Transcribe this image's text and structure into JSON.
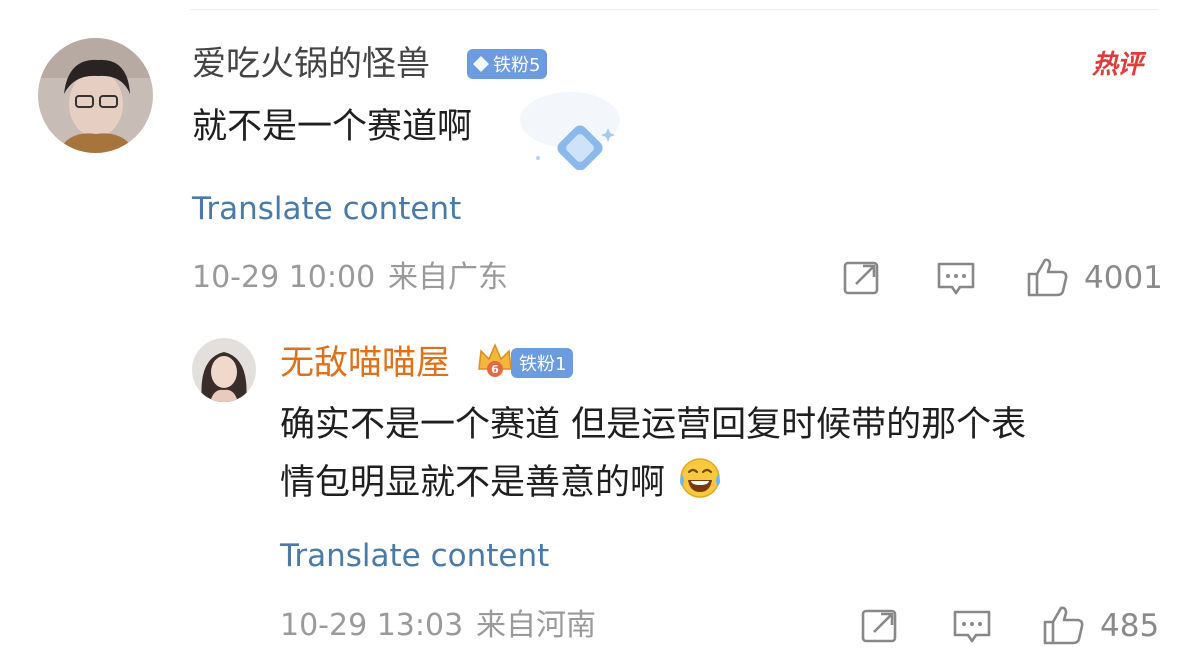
{
  "comment": {
    "username": "爱吃火锅的怪兽",
    "fan_badge": "铁粉5",
    "hot_tag": "热评",
    "text": "就不是一个赛道啊",
    "translate": "Translate content",
    "timestamp": "10-29 10:00",
    "location": "来自广东",
    "likes": "4001",
    "colors": {
      "username": "#444444",
      "badge": "#6d9be0",
      "hot_tag": "#e03b3b"
    }
  },
  "reply": {
    "username": "无敌喵喵屋",
    "fan_badge": "铁粉1",
    "crown_level": "6",
    "text_line1": "确实不是一个赛道 但是运营回复时候带的那个表",
    "text_line2": "情包明显就不是善意的啊",
    "emoji": "😂",
    "translate": "Translate content",
    "timestamp": "10-29 13:03",
    "location": "来自河南",
    "likes": "485",
    "colors": {
      "username": "#e0711c",
      "badge": "#6d9be0"
    }
  },
  "icons": {
    "share": "share-icon",
    "comment": "comment-icon",
    "like": "thumbs-up-icon"
  }
}
